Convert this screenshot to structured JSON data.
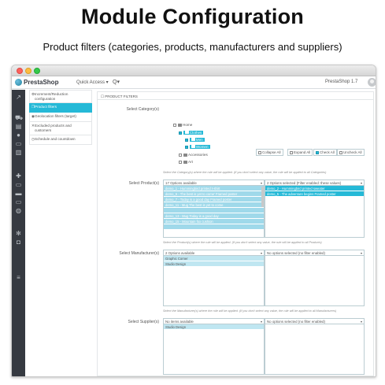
{
  "banner": {
    "title": "Module Configuration",
    "subtitle": "Product filters (categories, products, manufacturers and suppliers)"
  },
  "header": {
    "logo_text": "PrestaShop",
    "quick_access": "Quick Access ▾",
    "search_icon": "Q▾",
    "shop_name": "PrestaShop 1.7"
  },
  "sidenav": {
    "icons": [
      "trend-icon",
      "cart-icon",
      "store-icon",
      "user-icon",
      "chat-icon",
      "chart-icon",
      "puzzle-icon",
      "monitor-icon",
      "truck-icon",
      "card-icon",
      "globe-icon",
      "gear-icon",
      "settings-icon",
      "menu-icon"
    ]
  },
  "tabs": [
    {
      "label": "Increment/Reduction configuration",
      "icon": "⚙",
      "active": false
    },
    {
      "label": "Product filters",
      "icon": "❐",
      "active": true
    },
    {
      "label": "Geolocation filters (target)",
      "icon": "◉",
      "active": false
    },
    {
      "label": "Excluded products and customers",
      "icon": "✕",
      "active": false
    },
    {
      "label": "Schedule and countdown",
      "icon": "◷",
      "active": false
    }
  ],
  "panel": {
    "heading": "☐ PRODUCT FILTERS",
    "categories": {
      "label": "Select Category(s)",
      "buttons": {
        "collapse": "Collapse All",
        "expand": "Expand All",
        "check": "Check All",
        "uncheck": "Uncheck All"
      },
      "tree": [
        {
          "label": "Home",
          "checked": false,
          "selected": false
        },
        {
          "label": "Clothes",
          "checked": true,
          "selected": true
        },
        {
          "label": "Men",
          "checked": true,
          "selected": true
        },
        {
          "label": "Women",
          "checked": true,
          "selected": true
        },
        {
          "label": "Accessories",
          "checked": false,
          "selected": false
        },
        {
          "label": "Art",
          "checked": false,
          "selected": false
        }
      ],
      "help": "Select the Category(s) where the rule will be applied. (If you don't select any value, the rule will be applied to all Categories)"
    },
    "products": {
      "label": "Select Product(s)",
      "available_head": "17 Options available",
      "selected_head": "2 Options selected (Filter enabled: these values)",
      "available": [
        "demo_1 - Hummingbird printed t-shirt",
        "demo_6 - The best is yet to come' Framed poster",
        "demo_7 - Today is a good day Framed poster",
        "demo_11 - Mug The best is yet to come",
        "",
        "demo_13 - Mug Today is a good day",
        "demo_15 - Mountain fox cushion",
        ""
      ],
      "selected": [
        "demo_2 - Hummingbird printed sweater",
        "demo_5 - The adventure begins Framed poster"
      ],
      "help": "Select the Product(s) where the rule will be applied. (If you don't select any value, the rule will be applied to all Products)"
    },
    "manufacturers": {
      "label": "Select Manufacturer(s)",
      "available_head": "2 Options available",
      "selected_head": "No options selected (no filter enabled)",
      "available": [
        "Graphic Corner",
        "Studio Design"
      ],
      "help": "Select the Manufacturer(s) where the rule will be applied. (If you don't select any value, the rule will be applied to all Manufacturers)"
    },
    "suppliers": {
      "label": "Select Supplier(s)",
      "available_head": "No items available",
      "selected_head": "No options selected (no filter enabled)",
      "available": [
        "Studio Design"
      ]
    }
  }
}
